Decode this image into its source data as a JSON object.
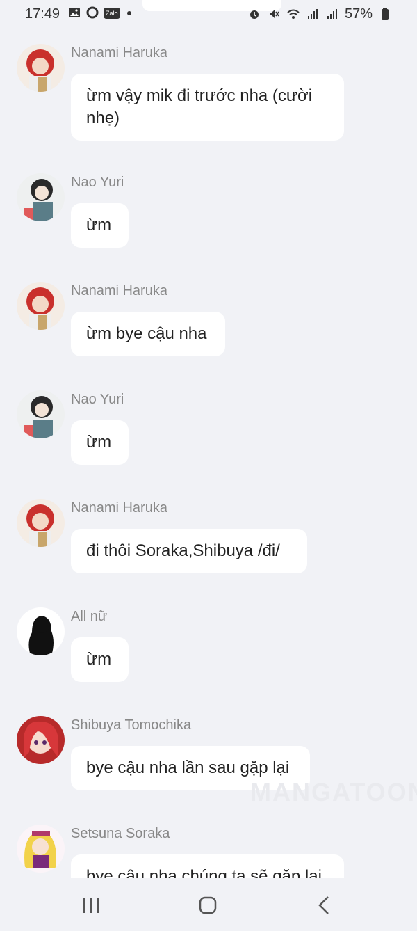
{
  "status": {
    "time": "17:49",
    "battery": "57%",
    "left_icons": [
      "image-icon",
      "circle-icon",
      "zalo-icon",
      "dot-icon"
    ],
    "zalo": "Zalo",
    "right_icons": [
      "alarm-icon",
      "mute-icon",
      "wifi-icon",
      "signal-icon",
      "signal-icon",
      "battery-icon"
    ]
  },
  "messages": [
    {
      "sender": "Nanami Haruka",
      "text": "ừm vậy mik đi trước nha (cười nhẹ)"
    },
    {
      "sender": "Nao Yuri",
      "text": "ừm"
    },
    {
      "sender": "Nanami Haruka",
      "text": "ừm bye cậu nha"
    },
    {
      "sender": "Nao Yuri",
      "text": "ừm"
    },
    {
      "sender": "Nanami Haruka",
      "text": "đi thôi Soraka,Shibuya /đi/"
    },
    {
      "sender": "All nữ",
      "text": "ừm"
    },
    {
      "sender": "Shibuya Tomochika",
      "text": "bye cậu nha lần sau gặp lại"
    },
    {
      "sender": "Setsuna Soraka",
      "text": "bye cậu nha chúng ta sẽ gặp lại"
    }
  ],
  "watermark": "MANGATOON",
  "navbar": {
    "icons": [
      "recent-apps-icon",
      "home-icon",
      "back-icon"
    ]
  },
  "colors": {
    "background": "#f1f2f6",
    "bubble": "#ffffff",
    "sender": "#888888"
  }
}
